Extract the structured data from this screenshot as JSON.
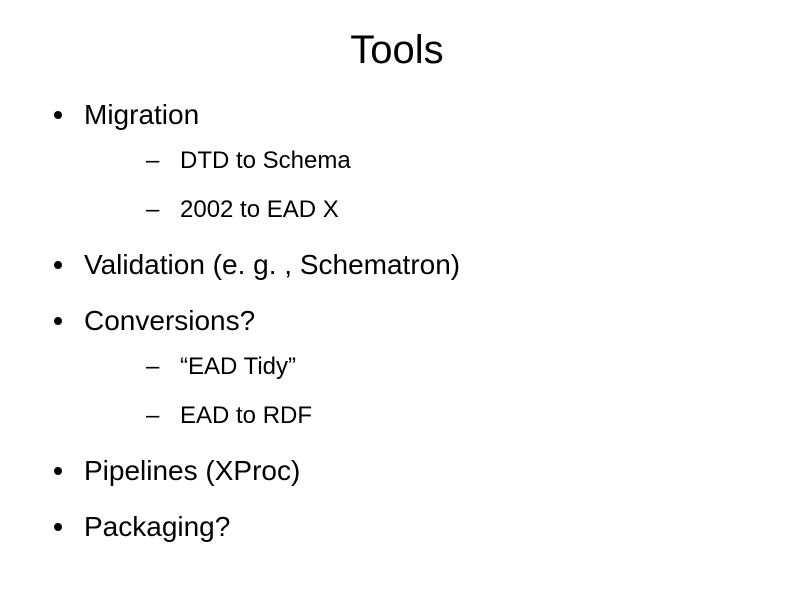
{
  "title": "Tools",
  "bullets": {
    "b0": {
      "label": "Migration",
      "sub": {
        "s0": "DTD to Schema",
        "s1": "2002 to EAD X"
      }
    },
    "b1": {
      "label": "Validation (e. g. , Schematron)"
    },
    "b2": {
      "label": "Conversions?",
      "sub": {
        "s0": "“EAD Tidy”",
        "s1": "EAD to RDF"
      }
    },
    "b3": {
      "label": "Pipelines (XProc)"
    },
    "b4": {
      "label": "Packaging?"
    }
  }
}
